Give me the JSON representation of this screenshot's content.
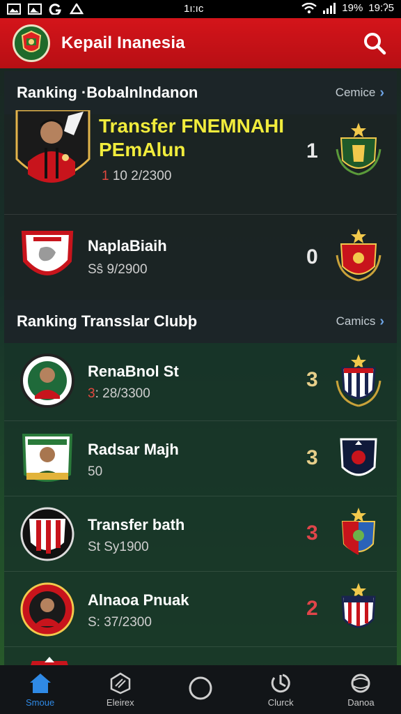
{
  "status_bar": {
    "time_center": "1ı:ıc",
    "battery": "19%",
    "time_right": "19:ʔ5"
  },
  "app_bar": {
    "title": "Kepail Inanesia",
    "search_icon": "search-icon"
  },
  "section_players": {
    "title": "Ranking ·Bobalnlndanon",
    "link": "Cemice",
    "featured": {
      "name_line1": "Transfer FNEMNAHI",
      "name_line2": "PEmAlun",
      "sub_highlight": "1",
      "sub_text": "10 2/2300",
      "rank": "1"
    },
    "rows": [
      {
        "name": "NaplaBiaih",
        "sub": "Sŝ 9/2900",
        "rank": "0"
      }
    ]
  },
  "section_clubs": {
    "title": "Ranking Transslar Clubþ",
    "link": "Camics",
    "rows": [
      {
        "name": "RenaBnol St",
        "sub_highlight": "3",
        "sub": ": 28/3300",
        "rank": "3"
      },
      {
        "name": "Radsar Majh",
        "sub_highlight": "",
        "sub": "50",
        "rank": "3"
      },
      {
        "name": "Transfer bath",
        "sub_highlight": "",
        "sub": "St Sy1900",
        "rank": "3"
      },
      {
        "name": "Alnaoa Pnuak",
        "sub_highlight": "",
        "sub": "S: 37/2300",
        "rank": "2"
      }
    ]
  },
  "bottom_nav": [
    {
      "label": "Smoue",
      "icon": "home-icon",
      "active": true
    },
    {
      "label": "Eleirex",
      "icon": "cube-icon",
      "active": false
    },
    {
      "label": "",
      "icon": "circle-icon",
      "active": false
    },
    {
      "label": "Clurck",
      "icon": "clock-icon",
      "active": false
    },
    {
      "label": "Danoa",
      "icon": "globe-icon",
      "active": false
    }
  ],
  "colors": {
    "brand_red": "#d4141a",
    "accent_yellow": "#f1ec3c",
    "rank_light": "#e8e8e8",
    "rank_gold": "#e7cf8a",
    "rank_red": "#e0454a",
    "nav_active": "#2f8ae6"
  }
}
